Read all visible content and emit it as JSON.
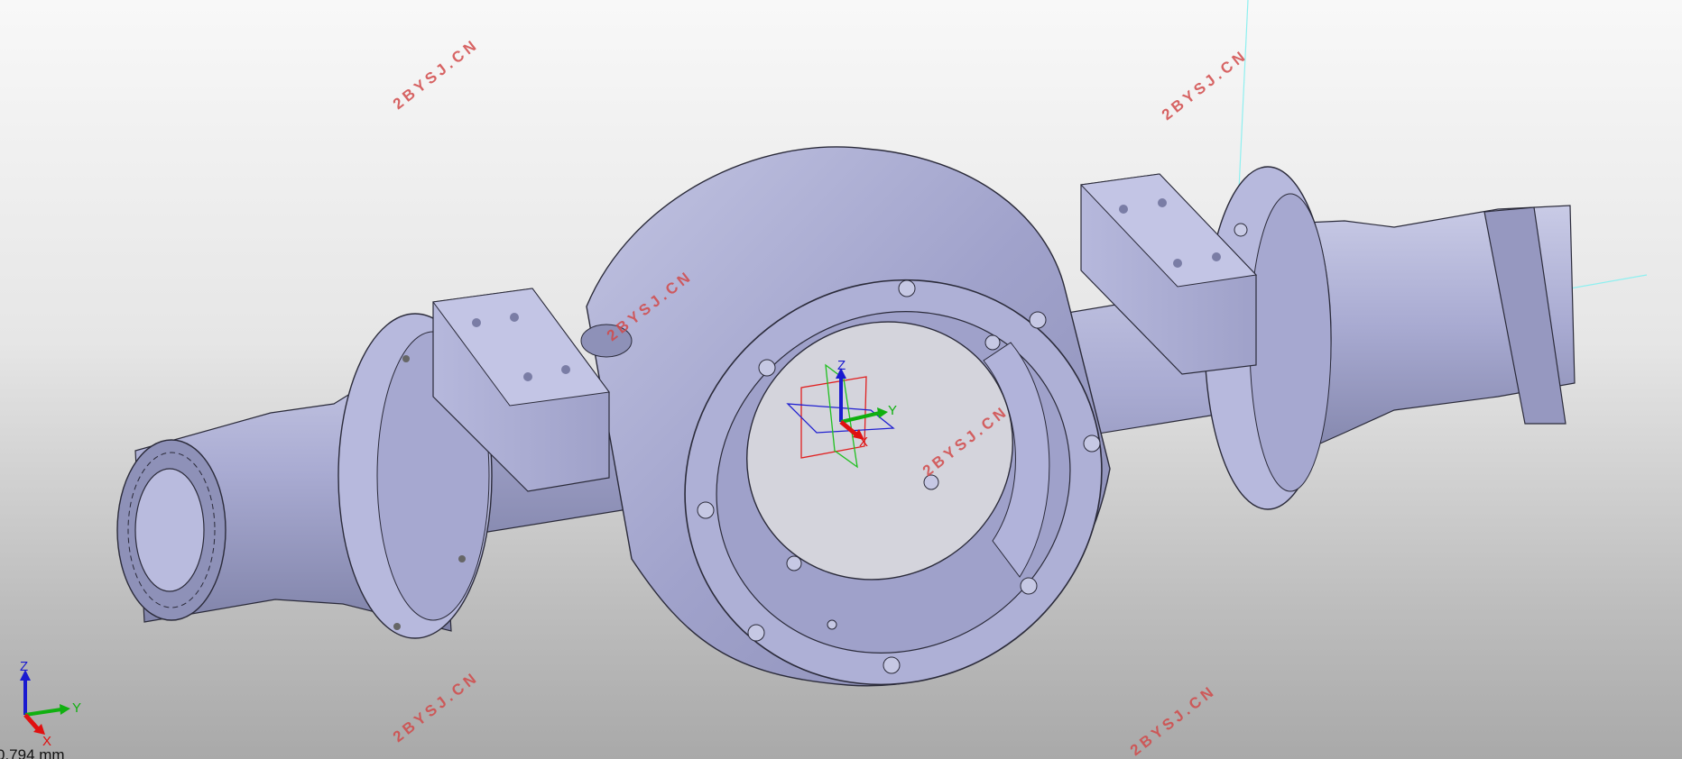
{
  "viewport": {
    "background_top": "#f8f8f8",
    "background_bottom": "#a9a9a9",
    "model_color": "#a3a5cd"
  },
  "watermarks": [
    "2BYSJ.CN",
    "2BYSJ.CN",
    "2BYSJ.CN",
    "2BYSJ.CN",
    "2BYSJ.CN",
    "2BYSJ.CN"
  ],
  "compass": {
    "icon": "3d-compass-icon",
    "labels": {
      "z": "Z",
      "y": "Y",
      "x": "X"
    }
  },
  "axis_triad": {
    "icon": "axis-triad-icon",
    "labels": {
      "z": "Z",
      "y": "Y",
      "x": "X"
    }
  },
  "scale_readout": "0.794 mm"
}
